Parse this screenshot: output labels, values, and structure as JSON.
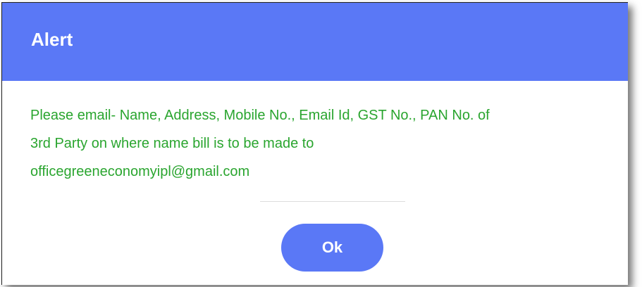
{
  "dialog": {
    "title": "Alert",
    "message_lines": [
      "Please email- Name, Address, Mobile No., Email Id, GST No., PAN No. of",
      "3rd Party on where name bill is to be made to",
      "officegreeneconomyipl@gmail.com"
    ],
    "ok_label": "Ok"
  },
  "colors": {
    "header": "#5a78f6",
    "message_text": "#2aa52f",
    "button": "#5a78f6"
  }
}
